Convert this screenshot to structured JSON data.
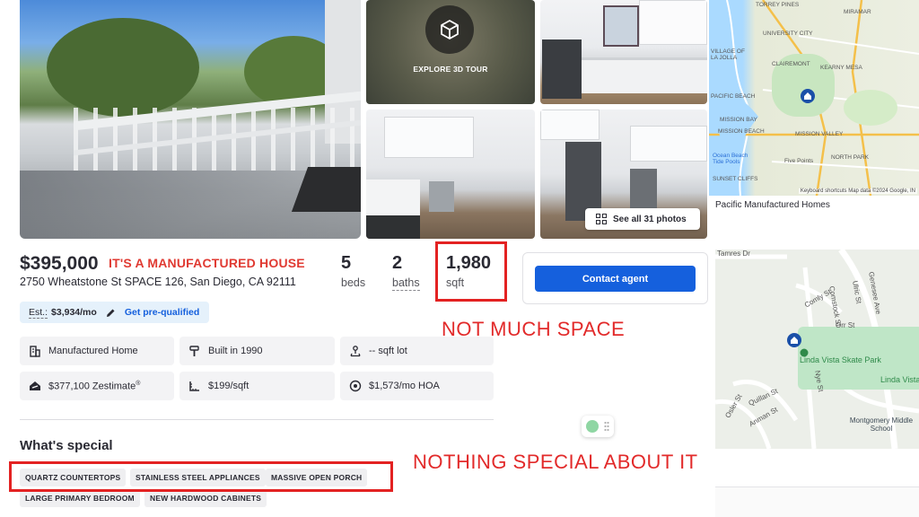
{
  "photos": {
    "tour_label": "EXPLORE 3D TOUR",
    "see_all_label": "See all 31 photos"
  },
  "map_top": {
    "labels": {
      "torrey_pines": "TORREY PINES",
      "miramar": "MIRAMAR",
      "university_city": "UNIVERSITY CITY",
      "village_la_jolla": "VILLAGE OF LA JOLLA",
      "clairemont": "CLAIREMONT",
      "kearny_mesa": "KEARNY MESA",
      "pacific_beach": "PACIFIC BEACH",
      "mission_bay": "MISSION BAY",
      "mission_beach": "MISSION BEACH",
      "mission_valley": "MISSION VALLEY",
      "ocean_beach": "Ocean Beach Tide Pools",
      "five_points": "Five Points",
      "north_park": "NORTH PARK",
      "sunset_cliffs": "SUNSET CLIFFS"
    },
    "credit": "Keyboard shortcuts   Map data ©2024 Google, IN",
    "caption": "Pacific Manufactured Homes"
  },
  "map_bottom": {
    "labels": {
      "tamres_dr": "Tamres Dr",
      "genesee_ave": "Genesee Ave",
      "comly_st": "Comly St",
      "comstock_st": "Comstock St",
      "ulric_st": "Ulric St",
      "orr_st": "Orr St",
      "skate_park": "Linda Vista Skate Park",
      "nye_st": "Nye St",
      "quillan_st": "Quillan St",
      "osler_st": "Osler St",
      "anman_st": "Anman St",
      "linda_vista": "Linda Vista",
      "middle_school": "Montgomery Middle School"
    }
  },
  "listing": {
    "price": "$395,000",
    "address": "2750 Wheatstone St SPACE 126, San Diego, CA 92111",
    "beds_value": "5",
    "beds_label": "beds",
    "baths_value": "2",
    "baths_label": "baths",
    "sqft_value": "1,980",
    "sqft_label": "sqft",
    "contact_label": "Contact agent",
    "estimate_prefix": "Est.:",
    "estimate_value": "$3,934/mo",
    "prequal_label": "Get pre-qualified"
  },
  "facts": {
    "type": "Manufactured Home",
    "built": "Built in 1990",
    "lot": "-- sqft lot",
    "zestimate": "$377,100 Zestimate",
    "zestimate_mark": "®",
    "price_per_sqft": "$199/sqft",
    "hoa": "$1,573/mo HOA"
  },
  "special": {
    "title": "What's special",
    "tags": [
      "QUARTZ COUNTERTOPS",
      "STAINLESS STEEL APPLIANCES",
      "MASSIVE OPEN PORCH",
      "LARGE PRIMARY BEDROOM",
      "NEW HARDWOOD CABINETS"
    ]
  },
  "annotations": {
    "manufactured": "IT'S A MANUFACTURED HOUSE",
    "space": "NOT MUCH SPACE",
    "special": "NOTHING SPECIAL ABOUT IT",
    "color": "#e22a2a"
  },
  "colors": {
    "accent": "#1560dd",
    "chip_bg": "#efeff1",
    "prequal_bg": "#e5f1fb"
  }
}
